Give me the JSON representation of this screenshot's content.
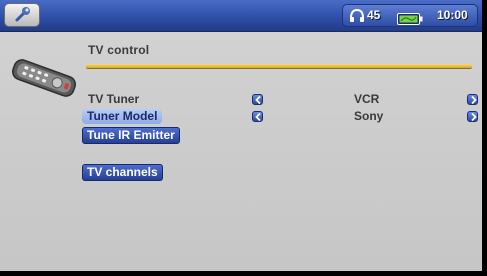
{
  "status": {
    "volume": "45",
    "time": "10:00"
  },
  "page": {
    "title": "TV control"
  },
  "settings": [
    {
      "label": "TV Tuner",
      "value": "VCR"
    },
    {
      "label": "Tuner Model",
      "value": "Sony"
    }
  ],
  "actions": {
    "tune_ir": "Tune IR Emitter",
    "tv_channels": "TV channels"
  },
  "colors": {
    "topbar": "#2f4fa8",
    "accent_line": "#e0b444",
    "button": "#2f4fa8",
    "selection": "#a9c0f0"
  }
}
